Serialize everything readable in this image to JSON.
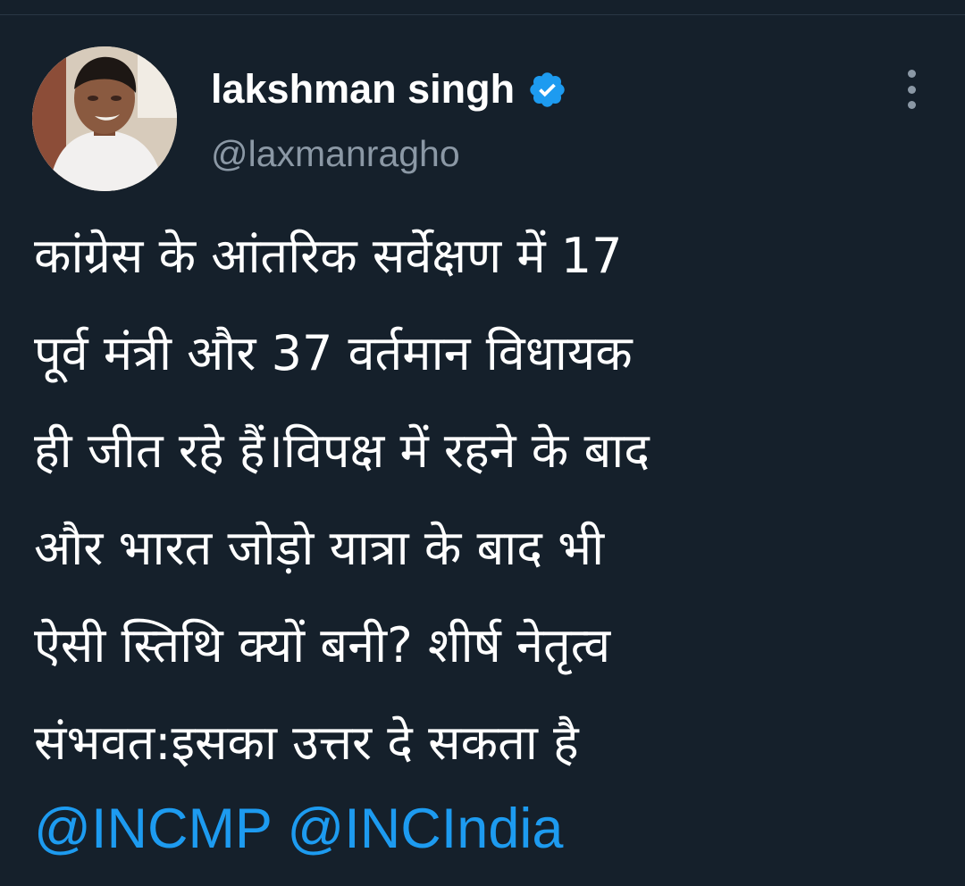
{
  "tweet": {
    "author": {
      "display_name": "lakshman singh",
      "handle": "@laxmanragho",
      "verified": true
    },
    "text_lines": [
      "कांग्रेस के आंतरिक सर्वेक्षण में 17",
      "पूर्व मंत्री और 37 वर्तमान विधायक",
      "ही जीत रहे हैं।विपक्ष में रहने के बाद",
      "और भारत जोड़ो यात्रा के बाद भी",
      "ऐसी स्तिथि क्यों बनी? शीर्ष नेतृत्व",
      "संभवत:इसका उत्तर दे सकता है"
    ],
    "mentions": [
      "@INCMP",
      "@INCIndia"
    ]
  },
  "icons": {
    "verified": "verified-badge-icon",
    "more": "more-options-icon"
  },
  "colors": {
    "background": "#15202b",
    "text": "#ffffff",
    "secondary_text": "#8b98a5",
    "accent": "#1d9bf0"
  }
}
